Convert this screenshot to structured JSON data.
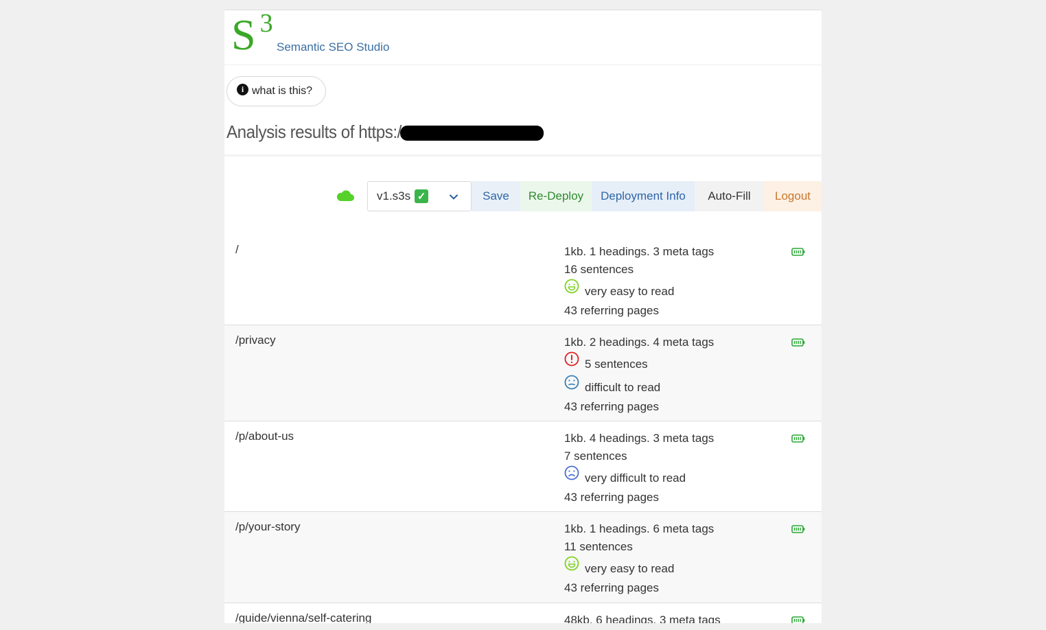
{
  "brand": {
    "logo_letter": "S",
    "logo_sup": "3",
    "name": "Semantic SEO Studio"
  },
  "info_button": {
    "label": "what is this?"
  },
  "analysis": {
    "title": "Analysis results of https:/"
  },
  "toolbar": {
    "version": "v1.s3s",
    "version_check": "✓",
    "buttons": {
      "save": "Save",
      "redeploy": "Re-Deploy",
      "deployment_info": "Deployment Info",
      "autofill": "Auto-Fill",
      "logout": "Logout"
    }
  },
  "colors": {
    "accent_green": "#3aa827",
    "cloud": "#55d12a",
    "warning_red": "#e02020",
    "sad_blue": "#4a6fd0",
    "easy_green": "#7ed321"
  },
  "pages": [
    {
      "path": "/",
      "summary": "1kb. 1 headings. 3 meta tags",
      "sentences": "16 sentences",
      "sentences_warning": false,
      "readability": "very easy to read",
      "readability_icon": "happy-face-icon",
      "referring": "43 referring pages"
    },
    {
      "path": "/privacy",
      "summary": "1kb. 2 headings. 4 meta tags",
      "sentences": "5 sentences",
      "sentences_warning": true,
      "readability": "difficult to read",
      "readability_icon": "neutral-face-icon",
      "referring": "43 referring pages"
    },
    {
      "path": "/p/about-us",
      "summary": "1kb. 4 headings. 3 meta tags",
      "sentences": "7 sentences",
      "sentences_warning": false,
      "readability": "very difficult to read",
      "readability_icon": "sad-face-icon",
      "referring": "43 referring pages"
    },
    {
      "path": "/p/your-story",
      "summary": "1kb. 1 headings. 6 meta tags",
      "sentences": "11 sentences",
      "sentences_warning": false,
      "readability": "very easy to read",
      "readability_icon": "happy-face-icon",
      "referring": "43 referring pages"
    },
    {
      "path": "/guide/vienna/self-catering",
      "summary": "48kb. 6 headings. 3 meta tags"
    }
  ]
}
